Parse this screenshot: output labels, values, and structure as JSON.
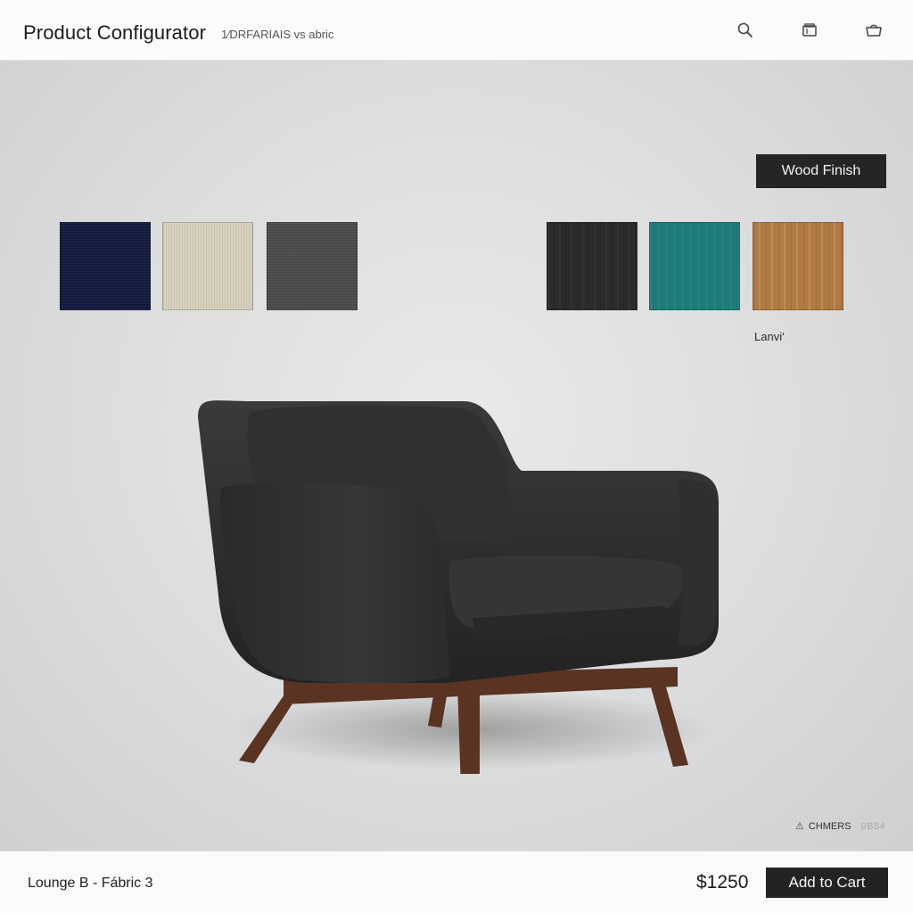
{
  "header": {
    "title": "Product Configurator",
    "subtitle": "1⁄DRFARIAIS vs abric",
    "icons": [
      "search-icon",
      "compare-icon",
      "cart-icon"
    ]
  },
  "fabric_swatches": [
    {
      "name": "navy",
      "color": "#131a3e"
    },
    {
      "name": "beige",
      "color": "#d8d0bd"
    },
    {
      "name": "charcoal",
      "color": "#4b4b4b"
    }
  ],
  "wood_swatches": [
    {
      "name": "ebony",
      "color": "#2b2b2b"
    },
    {
      "name": "teal",
      "color": "#1d7a78"
    },
    {
      "name": "oak",
      "color": "#b07a45"
    }
  ],
  "wood_finish_label": "Wood Finish",
  "swatch_caption": "Lanviʹ",
  "chair": {
    "upholstery_color": "#2c2c2d",
    "leg_color": "#5a3322"
  },
  "badge": {
    "label": "CHMERS",
    "code": "9B84"
  },
  "footer": {
    "product_name": "Lounge B - Fábric 3",
    "price": "$1250",
    "add_to_cart_label": "Add to Cart"
  }
}
